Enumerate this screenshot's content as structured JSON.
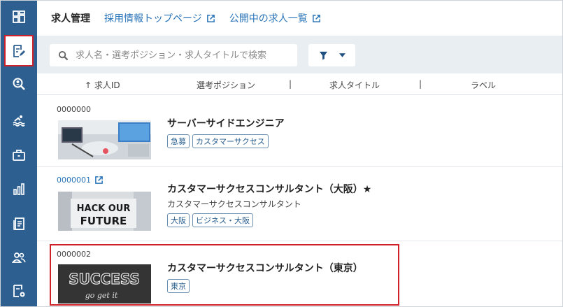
{
  "sidebar": {
    "items": [
      {
        "icon": "dashboard-icon"
      },
      {
        "icon": "job-edit-icon",
        "active": true
      },
      {
        "icon": "candidate-search-icon"
      },
      {
        "icon": "swimmer-icon"
      },
      {
        "icon": "briefcase-icon"
      },
      {
        "icon": "bar-chart-icon"
      },
      {
        "icon": "document-list-icon"
      },
      {
        "icon": "users-icon"
      },
      {
        "icon": "settings-doc-icon"
      }
    ]
  },
  "header": {
    "title": "求人管理",
    "links": [
      {
        "label": "採用情報トップページ",
        "icon": "external-link-icon"
      },
      {
        "label": "公開中の求人一覧",
        "icon": "external-link-icon"
      }
    ]
  },
  "search": {
    "placeholder": "求人名・選考ポジション・求人タイトルで検索",
    "value": ""
  },
  "columns": {
    "id": "↑ 求人ID",
    "position": "選考ポジション",
    "title": "求人タイトル",
    "label": "ラベル",
    "separator": "|"
  },
  "rows": [
    {
      "id": "0000000",
      "title": "サーバーサイドエンジニア",
      "subtitle": "",
      "tags": [
        "急募",
        "カスタマーサクセス"
      ]
    },
    {
      "id": "0000001",
      "title": "カスタマーサクセスコンサルタント（大阪）★",
      "subtitle": "カスタマーサクセスコンサルタント",
      "tags": [
        "大阪",
        "ビジネス・大阪"
      ],
      "thumb_text_1": "HACK OUR",
      "thumb_text_2": "FUTURE"
    },
    {
      "id": "0000002",
      "title": "カスタマーサクセスコンサルタント（東京）",
      "subtitle": "",
      "tags": [
        "東京"
      ],
      "thumb_text_1": "SUCCESS",
      "thumb_text_2": "go get it"
    }
  ],
  "colors": {
    "sidebar": "#2d5f91",
    "link": "#2a74b8",
    "highlight": "#d0202a"
  }
}
